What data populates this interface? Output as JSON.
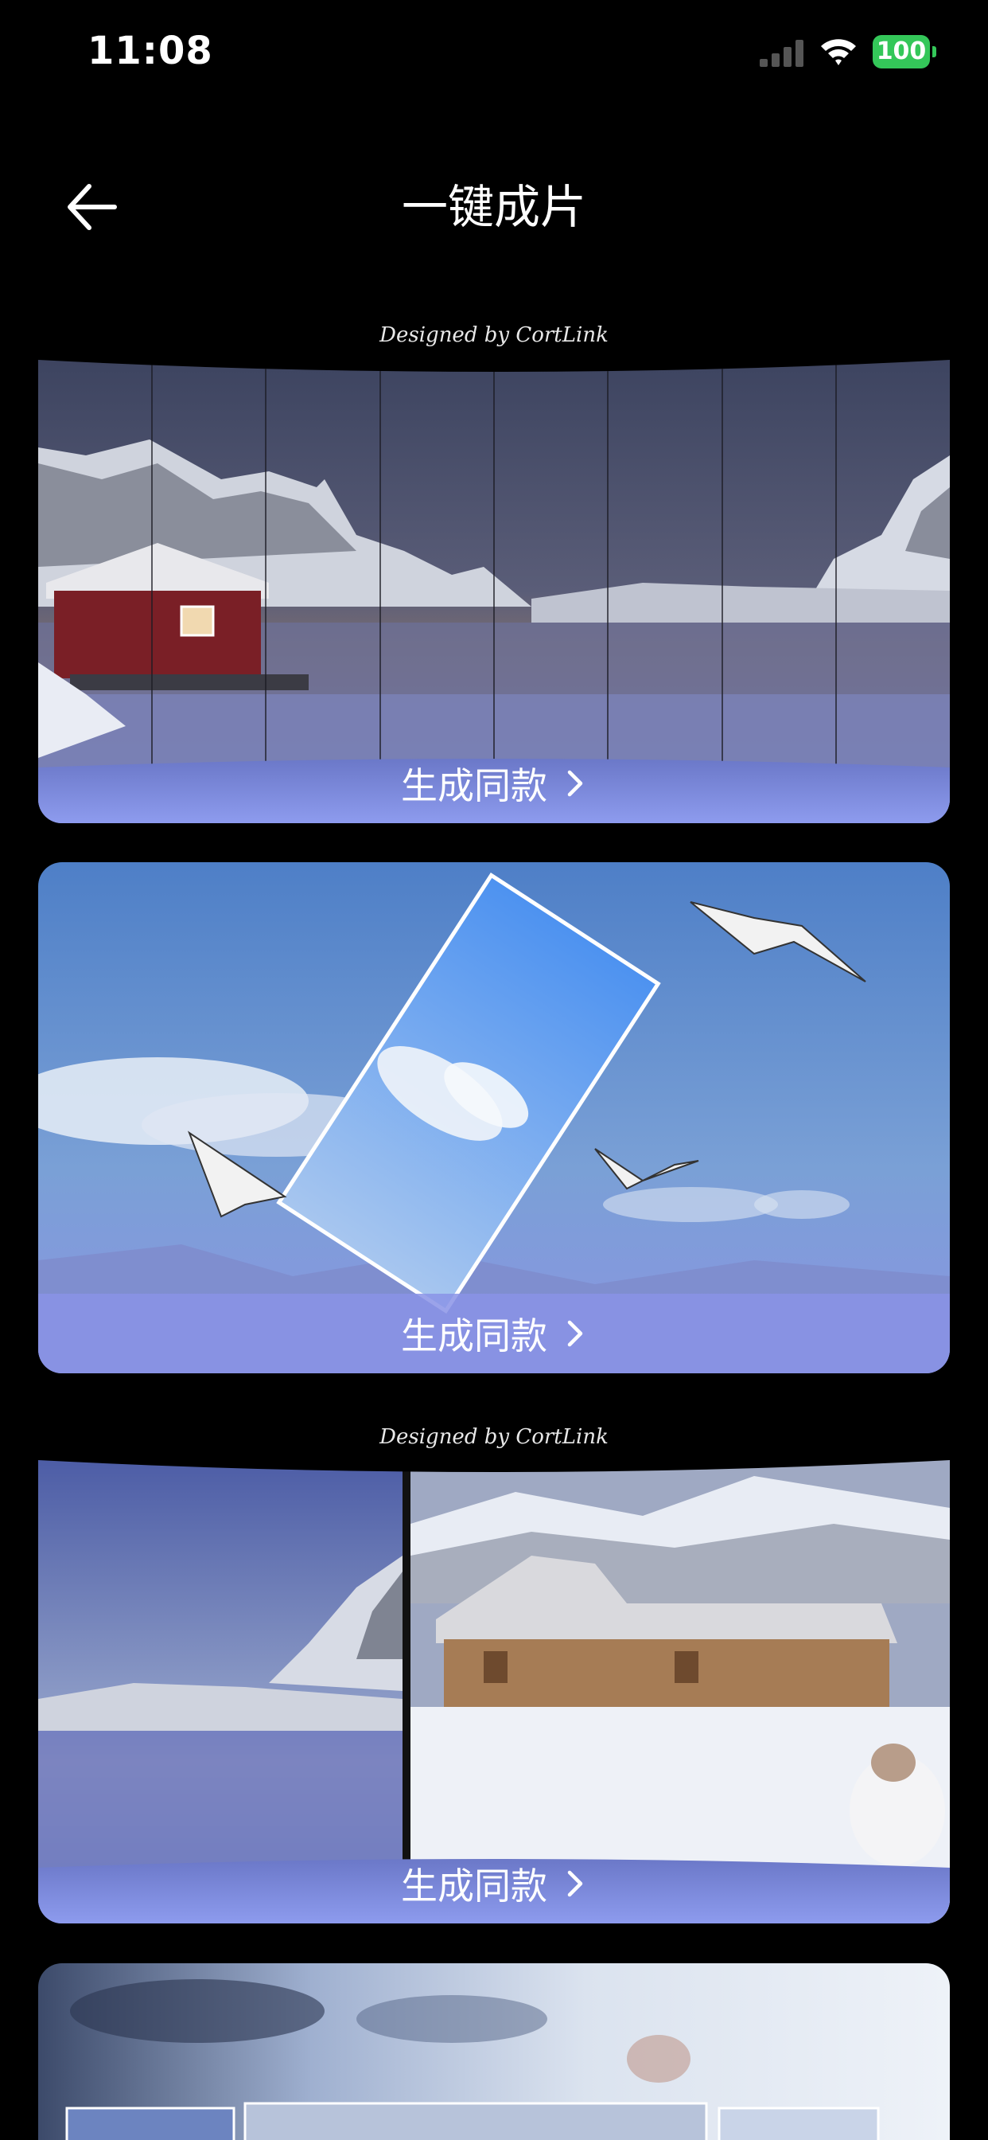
{
  "status_bar": {
    "time": "11:08",
    "battery": "100",
    "signal_icon": "cellular-signal-icon",
    "wifi_icon": "wifi-icon"
  },
  "nav": {
    "back_icon": "arrow-left-icon",
    "title": "一键成片"
  },
  "signature": "Designed by CortLink",
  "cards": [
    {
      "button_label": "生成同款",
      "chevron_icon": "chevron-right-icon"
    },
    {
      "button_label": "生成同款",
      "chevron_icon": "chevron-right-icon"
    },
    {
      "button_label": "生成同款",
      "chevron_icon": "chevron-right-icon"
    }
  ],
  "colors": {
    "background": "#000000",
    "button_gradient_top": "#7f8fe0",
    "button_gradient_bottom": "#8f9cf0",
    "battery": "#34c759"
  }
}
